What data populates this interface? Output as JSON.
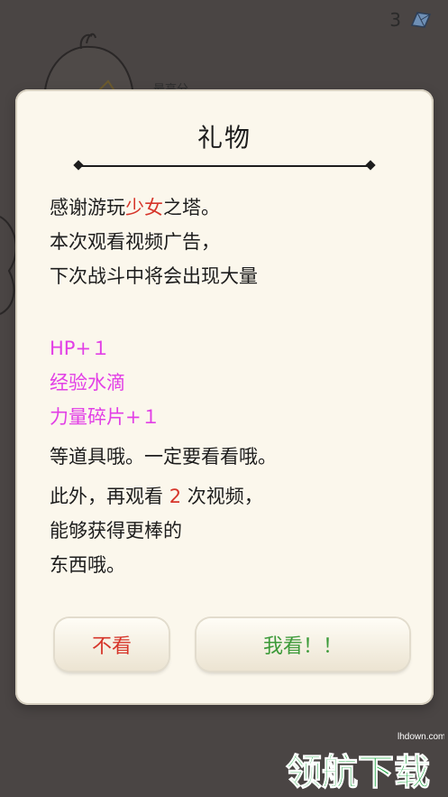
{
  "topbar": {
    "gem_count": "3",
    "gem_icon": "blue-crystal-icon"
  },
  "background": {
    "label": "最高分"
  },
  "dialog": {
    "title": "礼物",
    "line1_pre": "感谢游玩",
    "line1_red": "少女",
    "line1_post": "之塔。",
    "line2": "本次观看视频广告，",
    "line3": "下次战斗中将会出现大量",
    "reward1": "HP+１",
    "reward2": "经验水滴",
    "reward3": "力量碎片+１",
    "line4": "等道具哦。一定要看看哦。",
    "line5_pre": "此外，再观看 ",
    "line5_red": "2",
    "line5_post": " 次视频，",
    "line6": "能够获得更棒的",
    "line7": "东西哦。",
    "button_no": "不看",
    "button_yes": "我看！！"
  },
  "colors": {
    "accent_red": "#d6352a",
    "reward_magenta": "#e23fe6",
    "confirm_green": "#3c9a39",
    "dialog_bg": "#fbf7ec"
  },
  "watermark": {
    "site": "lhdown.com",
    "text": "领航下载"
  }
}
